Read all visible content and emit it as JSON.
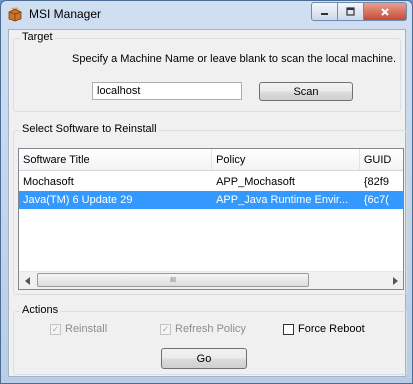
{
  "window": {
    "title": "MSI Manager",
    "icon": "app-package-icon"
  },
  "target": {
    "group_title": "Target",
    "hint": "Specify a Machine Name or leave blank to scan the local machine.",
    "machine_value": "localhost",
    "scan_label": "Scan"
  },
  "software": {
    "group_title": "Select Software to Reinstall",
    "columns": [
      "Software Title",
      "Policy",
      "GUID"
    ],
    "rows": [
      {
        "title": "Mochasoft",
        "policy": "APP_Mochasoft",
        "guid": "{82f9",
        "selected": false
      },
      {
        "title": "Java(TM) 6 Update 29",
        "policy": "APP_Java Runtime Envir...",
        "guid": "{6c7(",
        "selected": true
      }
    ],
    "scroll_thumb_grip": "III"
  },
  "actions": {
    "group_title": "Actions",
    "reinstall_label": "Reinstall",
    "reinstall_checked": true,
    "refresh_label": "Refresh Policy",
    "refresh_checked": true,
    "force_reboot_label": "Force Reboot",
    "force_reboot_checked": false,
    "go_label": "Go"
  },
  "colors": {
    "selection": "#3399ff",
    "window_frame": "#b9cde6",
    "close_button": "#c74a33"
  }
}
